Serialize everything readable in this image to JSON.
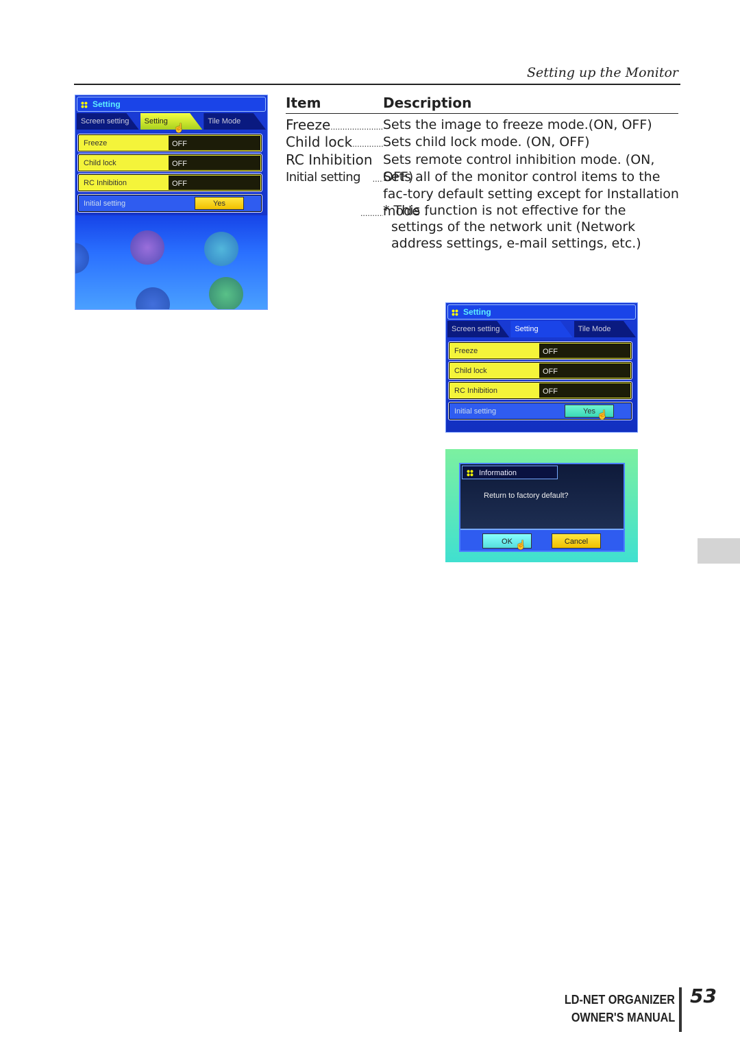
{
  "header": {
    "running_title": "Setting up the Monitor"
  },
  "table": {
    "col_item": "Item",
    "col_description": "Description",
    "rows": [
      {
        "item": "Freeze",
        "description": "Sets the image to freeze mode.(ON, OFF)"
      },
      {
        "item": "Child lock",
        "description": "Sets child lock mode. (ON, OFF)"
      },
      {
        "item": "RC Inhibition",
        "description": "Sets remote control inhibition mode. (ON, OFF)"
      },
      {
        "item": "Initial setting",
        "description": "Sets all of the monitor control items to the fac-tory default setting except for Installation mode ."
      }
    ],
    "note": "* This function is not effective for the settings of the network unit (Network address settings, e-mail settings, etc.)"
  },
  "menu": {
    "title": "Setting",
    "tabs": [
      "Screen setting",
      "Setting",
      "Tile Mode"
    ],
    "rows": [
      {
        "label": "Freeze",
        "value": "OFF"
      },
      {
        "label": "Child lock",
        "value": "OFF"
      },
      {
        "label": "RC Inhibition",
        "value": "OFF"
      }
    ],
    "initial_label": "Initial setting",
    "initial_button": "Yes"
  },
  "dialog": {
    "title": "Information",
    "message": "Return to factory default?",
    "ok": "OK",
    "cancel": "Cancel"
  },
  "footer": {
    "line1": "LD-NET ORGANIZER",
    "line2": "OWNER'S MANUAL",
    "page": "53"
  },
  "colors": {
    "panel_blue": "#1a3cd6",
    "row_yellow": "#f4f43a",
    "title_cyan": "#5ef0ff"
  }
}
